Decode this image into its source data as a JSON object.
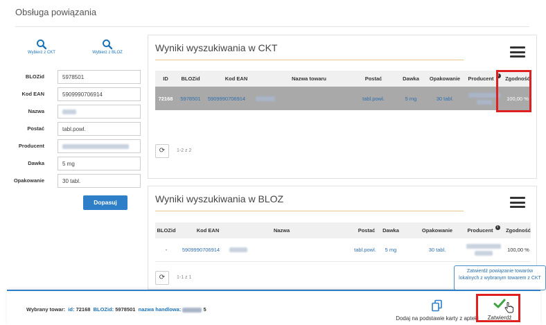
{
  "page": {
    "title": "Obsługa powiązania"
  },
  "search": {
    "ckt_label": "Wybierz z CKT",
    "bloz_label": "Wybierz z BLOZ"
  },
  "form": {
    "blozid": {
      "label": "BLOZid",
      "value": "5978501"
    },
    "ean": {
      "label": "Kod EAN",
      "value": "5909990706914"
    },
    "nazwa": {
      "label": "Nazwa",
      "value": ""
    },
    "postac": {
      "label": "Postać",
      "value": "tabl.powl."
    },
    "producent": {
      "label": "Producent",
      "value": ""
    },
    "dawka": {
      "label": "Dawka",
      "value": "5 mg"
    },
    "opakowanie": {
      "label": "Opakowanie",
      "value": "30 tabl."
    },
    "submit": "Dopasuj"
  },
  "ckt": {
    "title": "Wyniki wyszukiwania w CKT",
    "headers": {
      "id": "ID",
      "blozid": "BLOZid",
      "ean": "Kod EAN",
      "nazwa": "Nazwa towaru",
      "postac": "Postać",
      "dawka": "Dawka",
      "opakowanie": "Opakowanie",
      "producent": "Producent",
      "zgodnosc": "Zgodność"
    },
    "row": {
      "id": "72168",
      "blozid": "5978501",
      "ean": "5909990706914",
      "postac": "tabl.powl.",
      "dawka": "5 mg",
      "opakowanie": "30 tabl.",
      "zgodnosc": "100,00 %"
    },
    "pager": "1-2 z 2"
  },
  "bloz": {
    "title": "Wyniki wyszukiwania w BLOZ",
    "headers": {
      "blozid": "BLOZid",
      "ean": "Kod EAN",
      "nazwa": "Nazwa",
      "postac": "Postać",
      "dawka": "Dawka",
      "opakowanie": "Opakowanie",
      "producent": "Producent",
      "zgodnosc": "Zgodność"
    },
    "row": {
      "blozid": "-",
      "ean": "5909990706914",
      "postac": "tabl.powl.",
      "dawka": "5 mg",
      "opakowanie": "30 tabl.",
      "zgodnosc": "100,00 %"
    },
    "pager": "1-1 z 1"
  },
  "tooltip": "Zatwierdź powiązanie towarów lokalnych z wybranym towarem z CKT",
  "footer": {
    "selected_label": "Wybrany towar:",
    "id_key": "id:",
    "id_val": "72168",
    "bloz_key": "BLOZid:",
    "bloz_val": "5978501",
    "name_key": "nazwa handlowa:",
    "name_suffix": "5",
    "add_label": "Dodaj na podstawie karty z apteki",
    "confirm_label": "Zatwierdź"
  },
  "colors": {
    "accent": "#2e7fc7",
    "highlight": "#e02020",
    "selected_row": "#a9a9a9",
    "underline": "#e8c78a"
  }
}
